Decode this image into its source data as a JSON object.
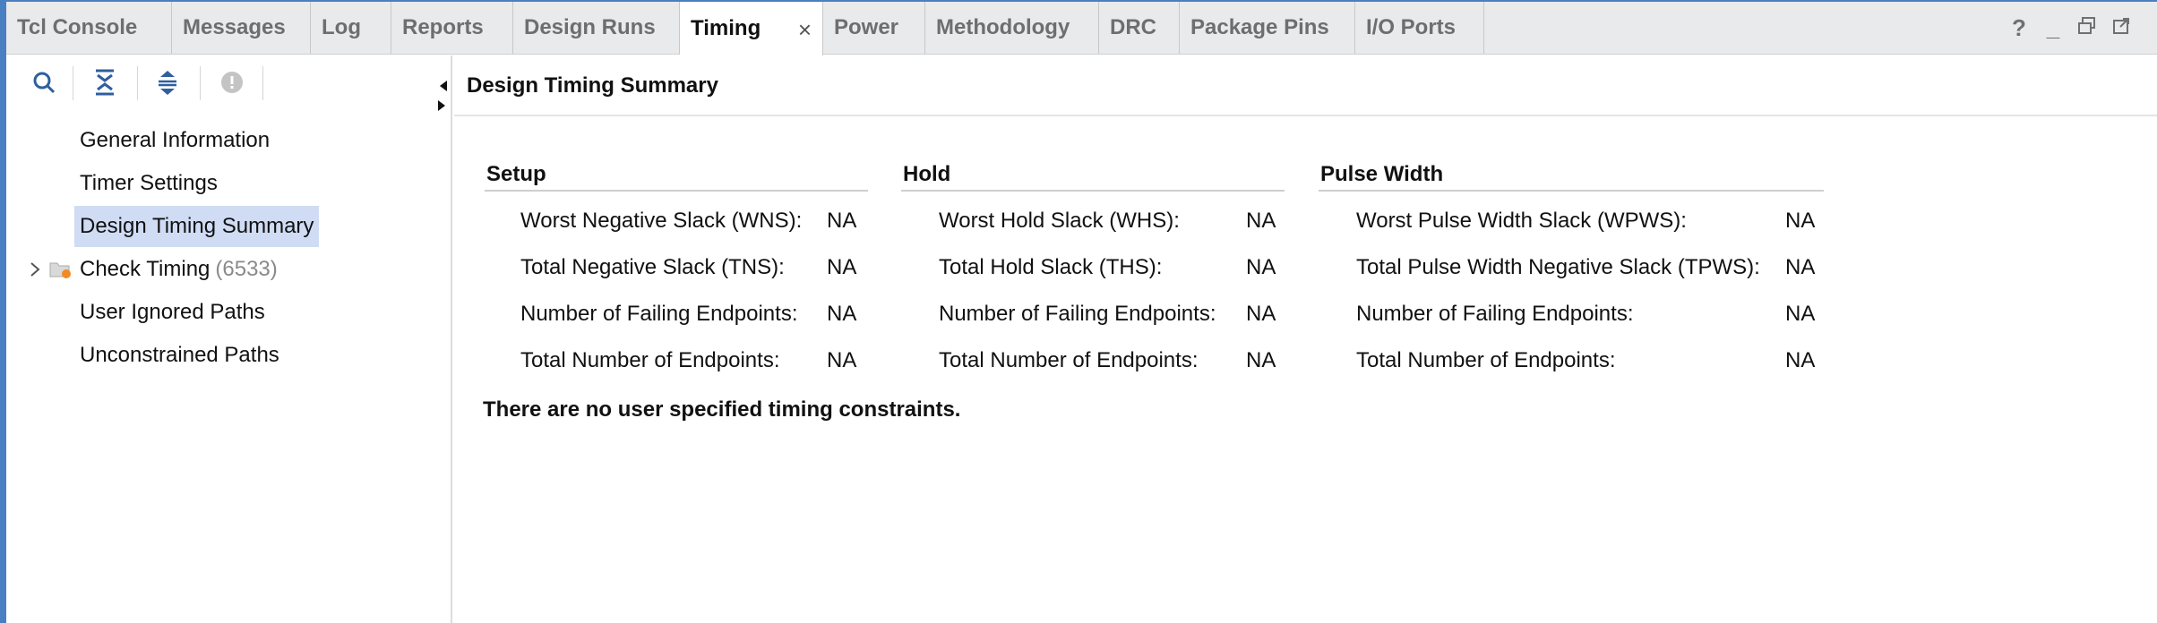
{
  "tabs": [
    {
      "label": "Tcl Console"
    },
    {
      "label": "Messages"
    },
    {
      "label": "Log"
    },
    {
      "label": "Reports"
    },
    {
      "label": "Design Runs"
    },
    {
      "label": "Timing",
      "close": "×"
    },
    {
      "label": "Power"
    },
    {
      "label": "Methodology"
    },
    {
      "label": "DRC"
    },
    {
      "label": "Package Pins"
    },
    {
      "label": "I/O Ports"
    }
  ],
  "window_controls": {
    "help": "?",
    "minimize": "_",
    "restore": "⧉",
    "float": "⇱"
  },
  "toolbar": {
    "icons": [
      "search-icon",
      "collapse-all-icon",
      "expand-all-icon",
      "info-icon"
    ]
  },
  "nav": {
    "items": [
      {
        "label": "General Information"
      },
      {
        "label": "Timer Settings"
      },
      {
        "label": "Design Timing Summary",
        "selected": true
      },
      {
        "label": "Check Timing",
        "count": "(6533)",
        "expandable": true
      },
      {
        "label": "User Ignored Paths"
      },
      {
        "label": "Unconstrained Paths"
      }
    ]
  },
  "content": {
    "title": "Design Timing Summary",
    "setup": {
      "heading": "Setup",
      "rows": [
        {
          "label": "Worst Negative Slack (WNS):",
          "value": "NA"
        },
        {
          "label": "Total Negative Slack (TNS):",
          "value": "NA"
        },
        {
          "label": "Number of Failing Endpoints:",
          "value": "NA"
        },
        {
          "label": "Total Number of Endpoints:",
          "value": "NA"
        }
      ]
    },
    "hold": {
      "heading": "Hold",
      "rows": [
        {
          "label": "Worst Hold Slack (WHS):",
          "value": "NA"
        },
        {
          "label": "Total Hold Slack (THS):",
          "value": "NA"
        },
        {
          "label": "Number of Failing Endpoints:",
          "value": "NA"
        },
        {
          "label": "Total Number of Endpoints:",
          "value": "NA"
        }
      ]
    },
    "pulse": {
      "heading": "Pulse Width",
      "rows": [
        {
          "label": "Worst Pulse Width Slack (WPWS):",
          "value": "NA"
        },
        {
          "label": "Total Pulse Width Negative Slack (TPWS):",
          "value": "NA"
        },
        {
          "label": "Number of Failing Endpoints:",
          "value": "NA"
        },
        {
          "label": "Total Number of Endpoints:",
          "value": "NA"
        }
      ]
    },
    "note": "There are no user specified timing constraints."
  },
  "colors": {
    "accent": "#4a7fc1",
    "selection": "#cfdcf4"
  }
}
